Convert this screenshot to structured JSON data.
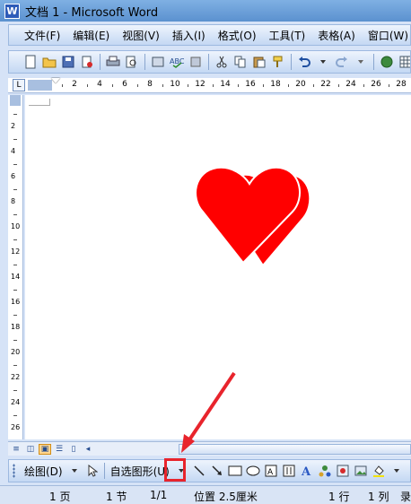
{
  "window": {
    "title": "文档 1 - Microsoft Word",
    "app_icon": "W"
  },
  "menu": {
    "items": [
      "文件(F)",
      "编辑(E)",
      "视图(V)",
      "插入(I)",
      "格式(O)",
      "工具(T)",
      "表格(A)",
      "窗口(W)"
    ]
  },
  "toolbar": {
    "icons": [
      "new-doc-icon",
      "open-folder-icon",
      "save-icon",
      "permission-icon",
      "print-icon",
      "print-preview-icon",
      "research-icon",
      "spelling-icon",
      "cut-icon",
      "copy-icon",
      "paste-icon",
      "format-painter-icon",
      "undo-icon",
      "redo-icon",
      "hyperlink-icon",
      "tables-borders-icon"
    ]
  },
  "ruler": {
    "corner_label": "L",
    "numbers": [
      "2",
      "4",
      "6",
      "8",
      "10",
      "12",
      "14",
      "16",
      "18",
      "20",
      "22",
      "24",
      "26",
      "28"
    ],
    "vertical_numbers": [
      "2",
      "4",
      "6",
      "8",
      "10",
      "12",
      "14",
      "16",
      "18",
      "20",
      "22",
      "24",
      "26"
    ]
  },
  "document": {
    "shapes": [
      {
        "type": "heart",
        "fill": "#ff0000"
      },
      {
        "type": "heart",
        "fill": "#ff0000"
      }
    ]
  },
  "drawing_toolbar": {
    "draw_label": "绘图(D)",
    "autoshapes_label": "自选图形(U)",
    "highlight_color": "#e8242c"
  },
  "statusbar": {
    "page": "1 页",
    "section": "1 节",
    "page_of": "1/1",
    "position": "位置 2.5厘米",
    "line": "1 行",
    "column": "1 列",
    "record": "录"
  }
}
